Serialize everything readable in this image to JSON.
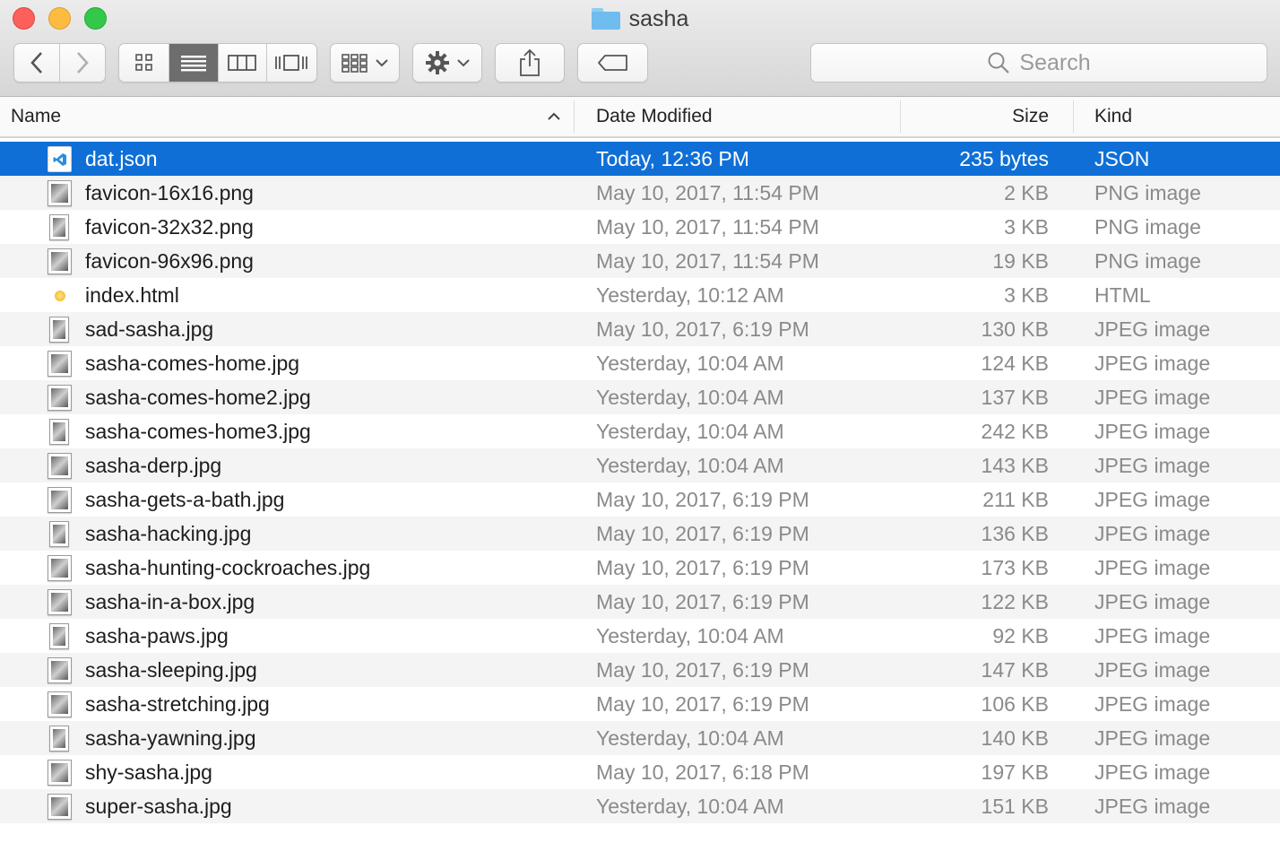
{
  "window": {
    "title": "sasha"
  },
  "toolbar": {
    "search_placeholder": "Search",
    "buttons": {
      "back": "chevron-left-icon",
      "forward": "chevron-right-icon",
      "view_icons": "grid-icon",
      "view_list": "list-icon",
      "view_columns": "columns-icon",
      "view_coverflow": "coverflow-icon",
      "arrange": "arrange-icon",
      "action": "gear-icon",
      "share": "share-icon",
      "tags": "tag-icon"
    }
  },
  "columns": {
    "name": "Name",
    "date": "Date Modified",
    "size": "Size",
    "kind": "Kind",
    "sort_indicator": "chevron-up-icon"
  },
  "colors": {
    "selection": "#0f6fd7",
    "close": "#fc605b",
    "minimize": "#fdbc40",
    "zoom": "#34c84a"
  },
  "files": [
    {
      "name": "dat.json",
      "date": "Today, 12:36 PM",
      "size": "235 bytes",
      "kind": "JSON",
      "icon": "vscode-file-icon",
      "selected": true
    },
    {
      "name": "favicon-16x16.png",
      "date": "May 10, 2017, 11:54 PM",
      "size": "2 KB",
      "kind": "PNG image",
      "icon": "image-thumbnail-icon"
    },
    {
      "name": "favicon-32x32.png",
      "date": "May 10, 2017, 11:54 PM",
      "size": "3 KB",
      "kind": "PNG image",
      "icon": "image-thumbnail-icon"
    },
    {
      "name": "favicon-96x96.png",
      "date": "May 10, 2017, 11:54 PM",
      "size": "19 KB",
      "kind": "PNG image",
      "icon": "image-thumbnail-icon"
    },
    {
      "name": "index.html",
      "date": "Yesterday, 10:12 AM",
      "size": "3 KB",
      "kind": "HTML",
      "icon": "html-file-icon"
    },
    {
      "name": "sad-sasha.jpg",
      "date": "May 10, 2017, 6:19 PM",
      "size": "130 KB",
      "kind": "JPEG image",
      "icon": "image-thumbnail-icon"
    },
    {
      "name": "sasha-comes-home.jpg",
      "date": "Yesterday, 10:04 AM",
      "size": "124 KB",
      "kind": "JPEG image",
      "icon": "image-thumbnail-icon"
    },
    {
      "name": "sasha-comes-home2.jpg",
      "date": "Yesterday, 10:04 AM",
      "size": "137 KB",
      "kind": "JPEG image",
      "icon": "image-thumbnail-icon"
    },
    {
      "name": "sasha-comes-home3.jpg",
      "date": "Yesterday, 10:04 AM",
      "size": "242 KB",
      "kind": "JPEG image",
      "icon": "image-thumbnail-icon"
    },
    {
      "name": "sasha-derp.jpg",
      "date": "Yesterday, 10:04 AM",
      "size": "143 KB",
      "kind": "JPEG image",
      "icon": "image-thumbnail-icon"
    },
    {
      "name": "sasha-gets-a-bath.jpg",
      "date": "May 10, 2017, 6:19 PM",
      "size": "211 KB",
      "kind": "JPEG image",
      "icon": "image-thumbnail-icon"
    },
    {
      "name": "sasha-hacking.jpg",
      "date": "May 10, 2017, 6:19 PM",
      "size": "136 KB",
      "kind": "JPEG image",
      "icon": "image-thumbnail-icon"
    },
    {
      "name": "sasha-hunting-cockroaches.jpg",
      "date": "May 10, 2017, 6:19 PM",
      "size": "173 KB",
      "kind": "JPEG image",
      "icon": "image-thumbnail-icon"
    },
    {
      "name": "sasha-in-a-box.jpg",
      "date": "May 10, 2017, 6:19 PM",
      "size": "122 KB",
      "kind": "JPEG image",
      "icon": "image-thumbnail-icon"
    },
    {
      "name": "sasha-paws.jpg",
      "date": "Yesterday, 10:04 AM",
      "size": "92 KB",
      "kind": "JPEG image",
      "icon": "image-thumbnail-icon"
    },
    {
      "name": "sasha-sleeping.jpg",
      "date": "May 10, 2017, 6:19 PM",
      "size": "147 KB",
      "kind": "JPEG image",
      "icon": "image-thumbnail-icon"
    },
    {
      "name": "sasha-stretching.jpg",
      "date": "May 10, 2017, 6:19 PM",
      "size": "106 KB",
      "kind": "JPEG image",
      "icon": "image-thumbnail-icon"
    },
    {
      "name": "sasha-yawning.jpg",
      "date": "Yesterday, 10:04 AM",
      "size": "140 KB",
      "kind": "JPEG image",
      "icon": "image-thumbnail-icon"
    },
    {
      "name": "shy-sasha.jpg",
      "date": "May 10, 2017, 6:18 PM",
      "size": "197 KB",
      "kind": "JPEG image",
      "icon": "image-thumbnail-icon"
    },
    {
      "name": "super-sasha.jpg",
      "date": "Yesterday, 10:04 AM",
      "size": "151 KB",
      "kind": "JPEG image",
      "icon": "image-thumbnail-icon"
    }
  ]
}
